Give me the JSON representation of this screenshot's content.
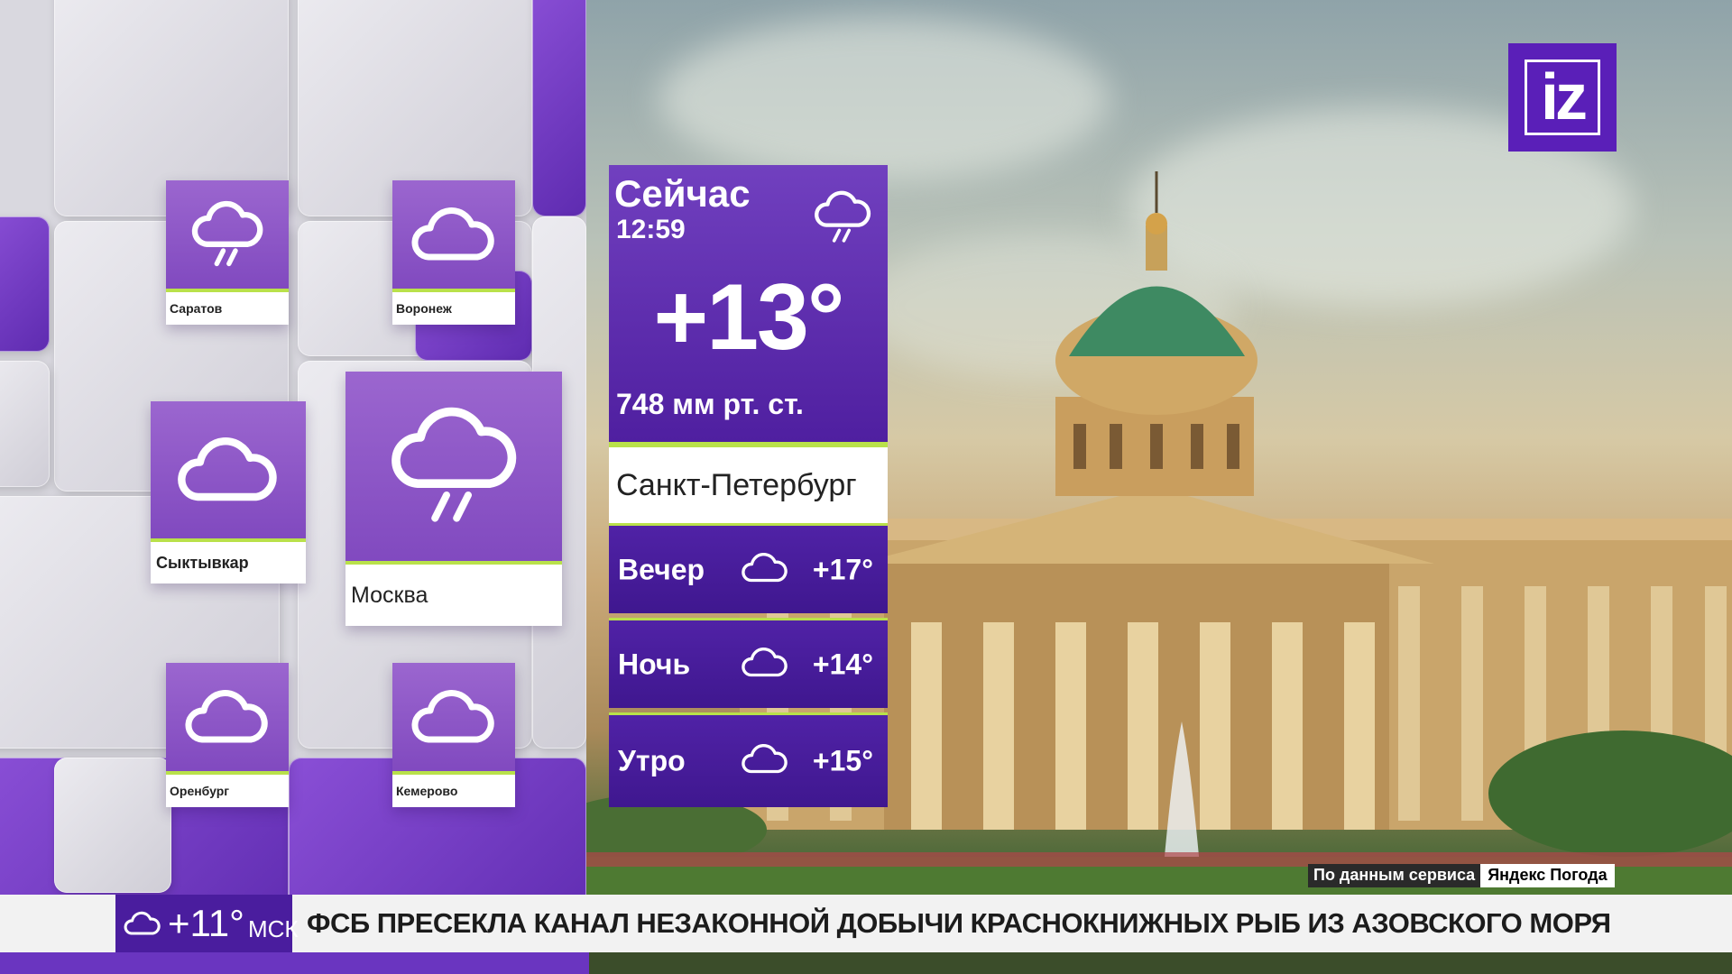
{
  "logo": {
    "text": "iz"
  },
  "current": {
    "title": "Сейчас",
    "time": "12:59",
    "temperature": "+13°",
    "pressure": "748 мм рт. ст.",
    "icon": "cloud-rain-icon",
    "city": "Санкт-Петербург"
  },
  "periods": [
    {
      "label": "Вечер",
      "temp": "+17°",
      "icon": "cloud-icon"
    },
    {
      "label": "Ночь",
      "temp": "+14°",
      "icon": "cloud-icon"
    },
    {
      "label": "Утро",
      "temp": "+15°",
      "icon": "cloud-icon"
    }
  ],
  "cities": [
    {
      "name": "Саратов",
      "icon": "cloud-rain-icon"
    },
    {
      "name": "Воронеж",
      "icon": "cloud-icon"
    },
    {
      "name": "Сыктывкар",
      "icon": "cloud-icon"
    },
    {
      "name": "Москва",
      "icon": "cloud-rain-icon"
    },
    {
      "name": "Оренбург",
      "icon": "cloud-icon"
    },
    {
      "name": "Кемерово",
      "icon": "cloud-icon"
    }
  ],
  "source": {
    "prefix": "По данным сервиса",
    "name": "Яндекс Погода"
  },
  "ticker": {
    "temperature": "+11°",
    "unit": "МСК",
    "icon": "cloud-icon",
    "headline": "ФСБ ПРЕСЕКЛА КАНАЛ НЕЗАКОННОЙ ДОБЫЧИ КРАСНОКНИЖНЫХ РЫБ ИЗ АЗОВСКОГО МОРЯ"
  },
  "colors": {
    "brand_purple": "#5a1fb8",
    "accent_green": "#b9e14a"
  }
}
